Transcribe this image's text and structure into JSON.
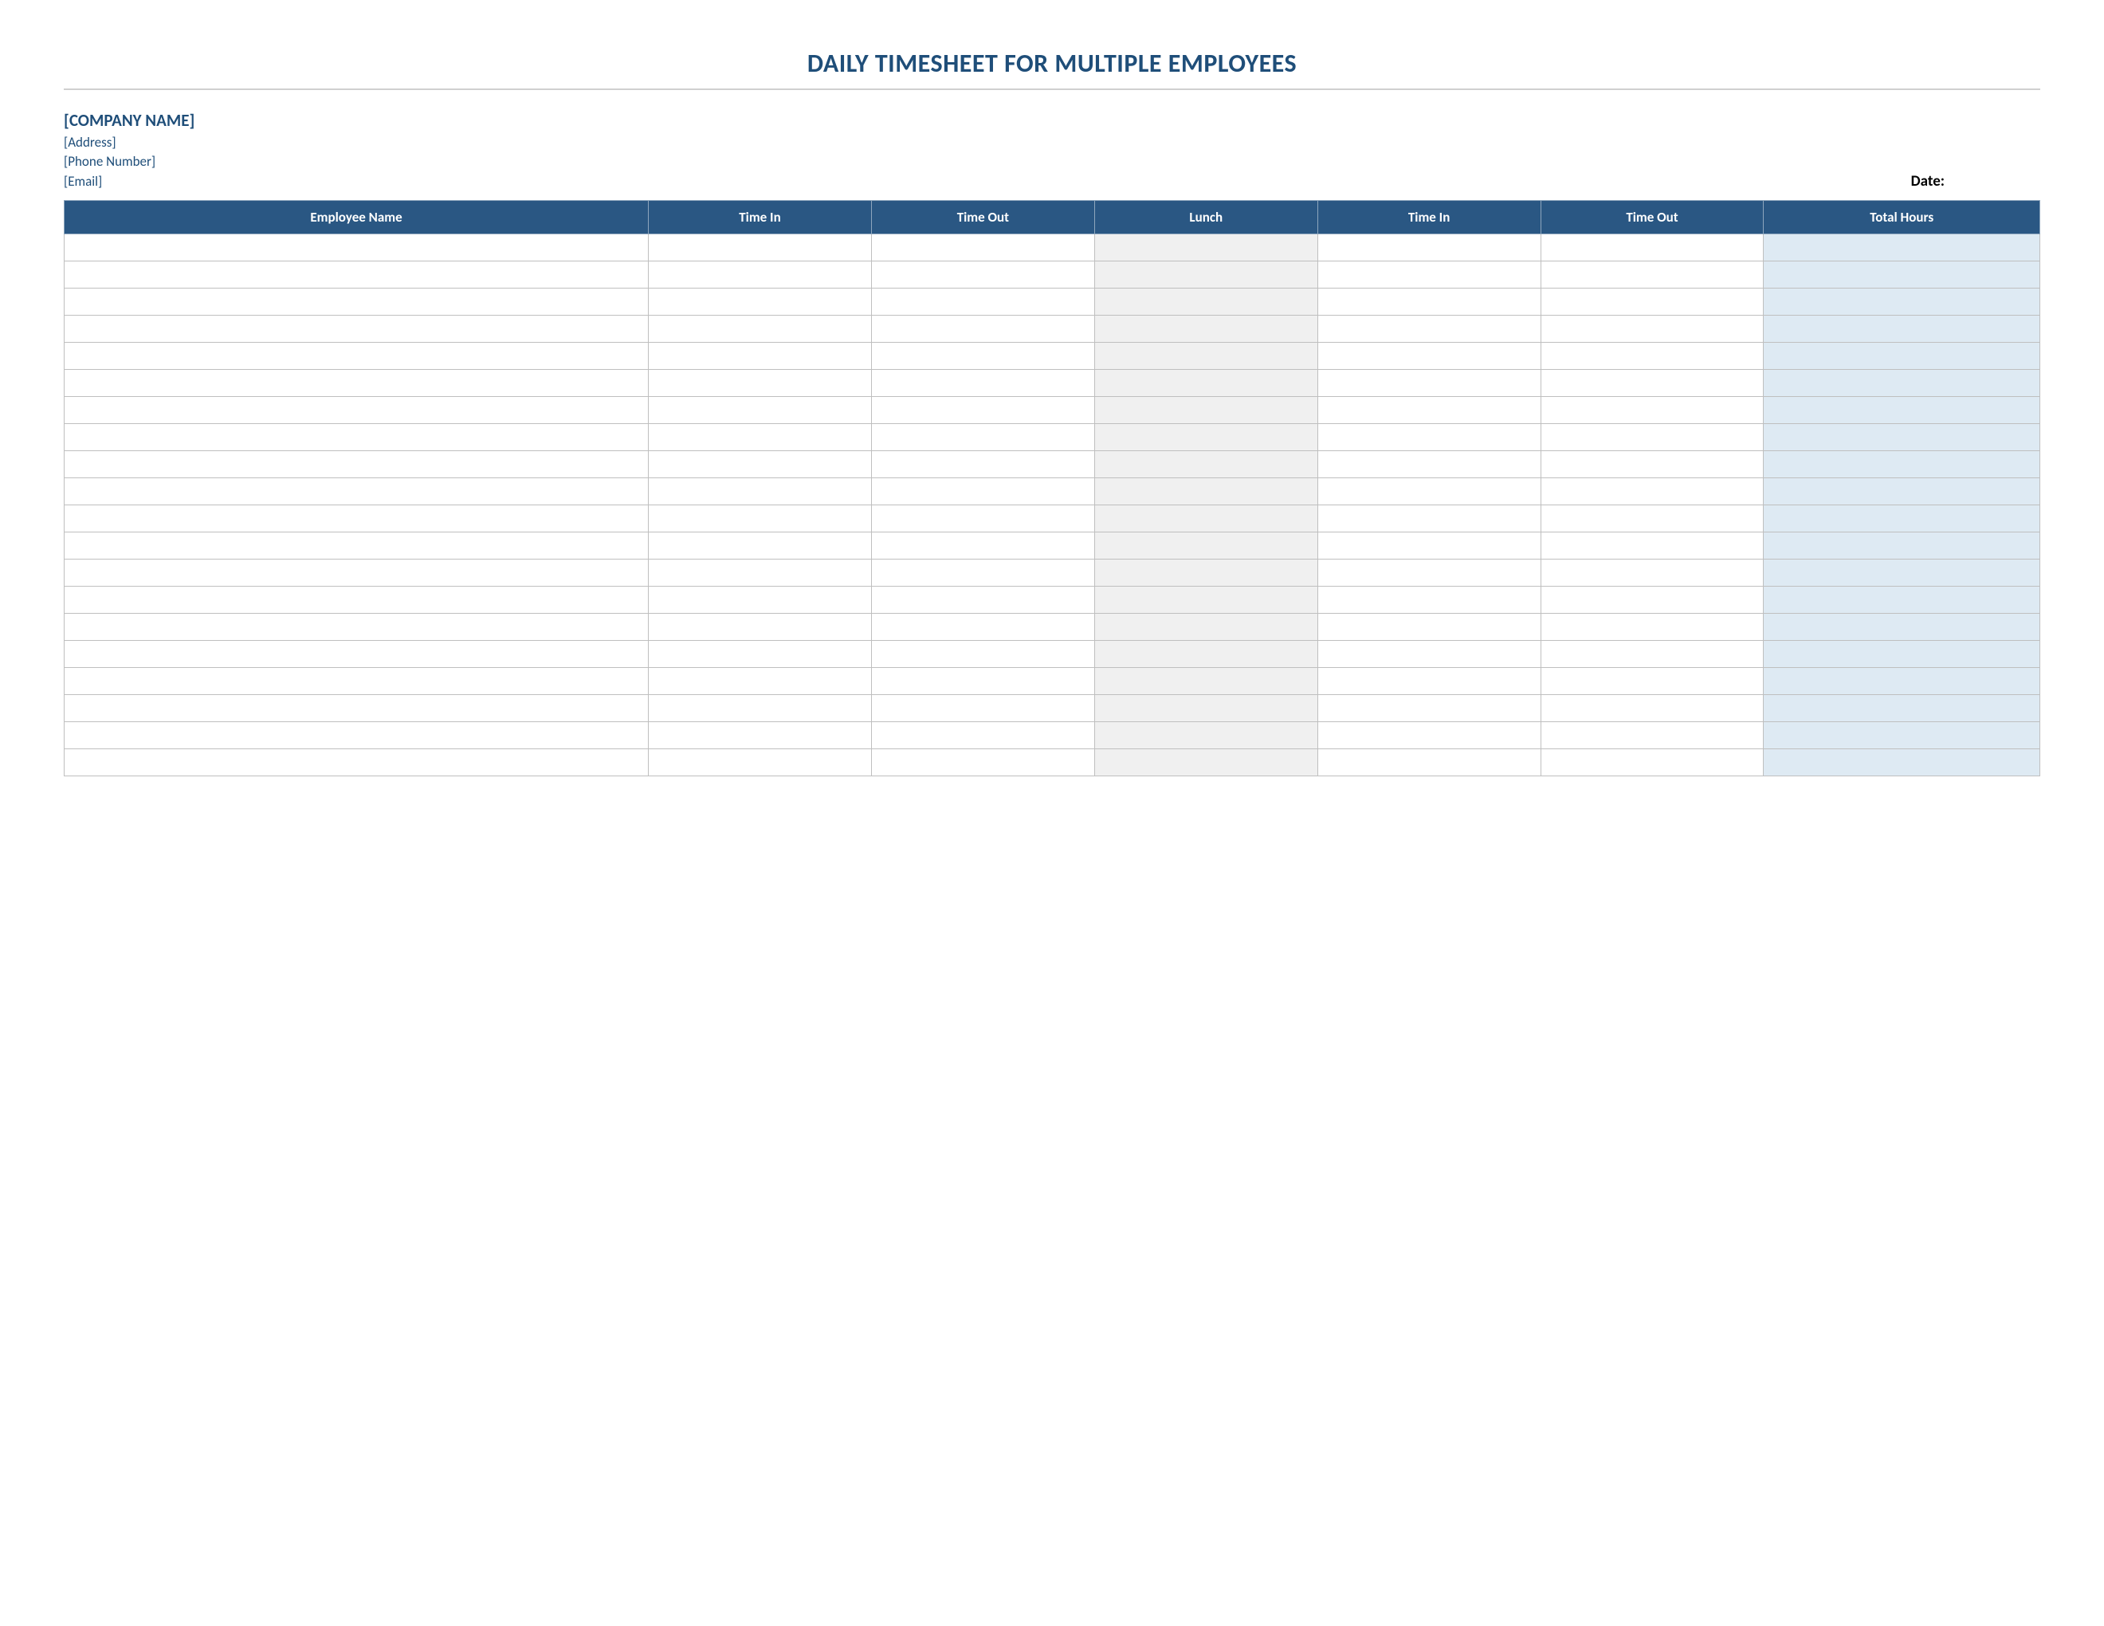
{
  "title": "DAILY TIMESHEET FOR MULTIPLE EMPLOYEES",
  "company": {
    "name": "[COMPANY NAME]",
    "address": "[Address]",
    "phone": "[Phone Number]",
    "email": "[Email]"
  },
  "date_label": "Date:",
  "columns": {
    "employee_name": "Employee Name",
    "time_in_1": "Time In",
    "time_out_1": "Time Out",
    "lunch": "Lunch",
    "time_in_2": "Time In",
    "time_out_2": "Time Out",
    "total_hours": "Total Hours"
  },
  "row_count": 20,
  "colors": {
    "accent": "#1f4e79",
    "header_bg": "#2a5783",
    "lunch_bg": "#f0f0f0",
    "total_bg": "#deeaf3"
  }
}
